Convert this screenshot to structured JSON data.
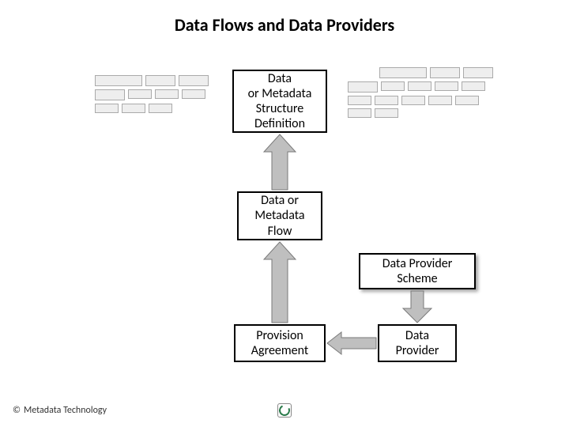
{
  "title": "Data Flows and Data Providers",
  "nodes": {
    "structure_def": "Data\nor Metadata\nStructure\nDefinition",
    "flow": "Data or\nMetadata\nFlow",
    "provider_scheme": "Data Provider\nScheme",
    "provision_agreement": "Provision\nAgreement",
    "data_provider": "Data\nProvider"
  },
  "footer": "Metadata Technology",
  "copyright_symbol": "©",
  "colors": {
    "arrow_fill": "#bfbfbf",
    "arrow_stroke": "#7a7a7a"
  }
}
